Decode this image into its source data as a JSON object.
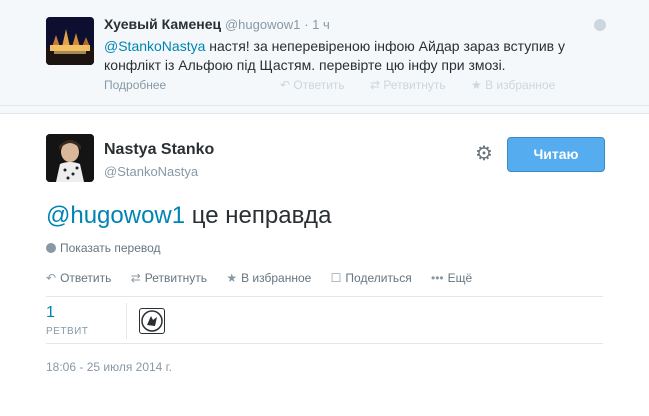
{
  "parent_tweet": {
    "fullname": "Хуевый Каменец",
    "screenname": "@hugowow1",
    "time": "· 1 ч",
    "mention": "@StankoNastya",
    "text": " настя! за неперевіреною інфою Айдар зараз вступив у конфлікт із Альфою під Щастям. перевірте цю інфу при змозі.",
    "more_label": "Подробнее",
    "actions": {
      "reply": "Ответить",
      "retweet": "Ретвитнуть",
      "favorite": "В избранное"
    }
  },
  "main_tweet": {
    "fullname": "Nastya Stanko",
    "screenname": "@StankoNastya",
    "follow_button": "Читаю",
    "mention": "@hugowow1",
    "text": " це неправда",
    "translate": "Показать перевод",
    "actions": {
      "reply": "Ответить",
      "retweet": "Ретвитнуть",
      "favorite": "В избранное",
      "share": "Поделиться",
      "more": "Ещё"
    },
    "stats": {
      "retweet_count": "1",
      "retweet_label": "РЕТВИТ"
    },
    "timestamp": "18:06 - 25 июля 2014 г."
  },
  "icons": {
    "reply": "reply-icon",
    "retweet": "retweet-icon",
    "favorite": "star-icon",
    "share": "share-icon",
    "more": "more-icon",
    "settings": "gear-icon",
    "translate": "globe-icon"
  },
  "colors": {
    "link": "#0084b4",
    "follow_button": "#55acee",
    "muted": "#8899a6"
  }
}
